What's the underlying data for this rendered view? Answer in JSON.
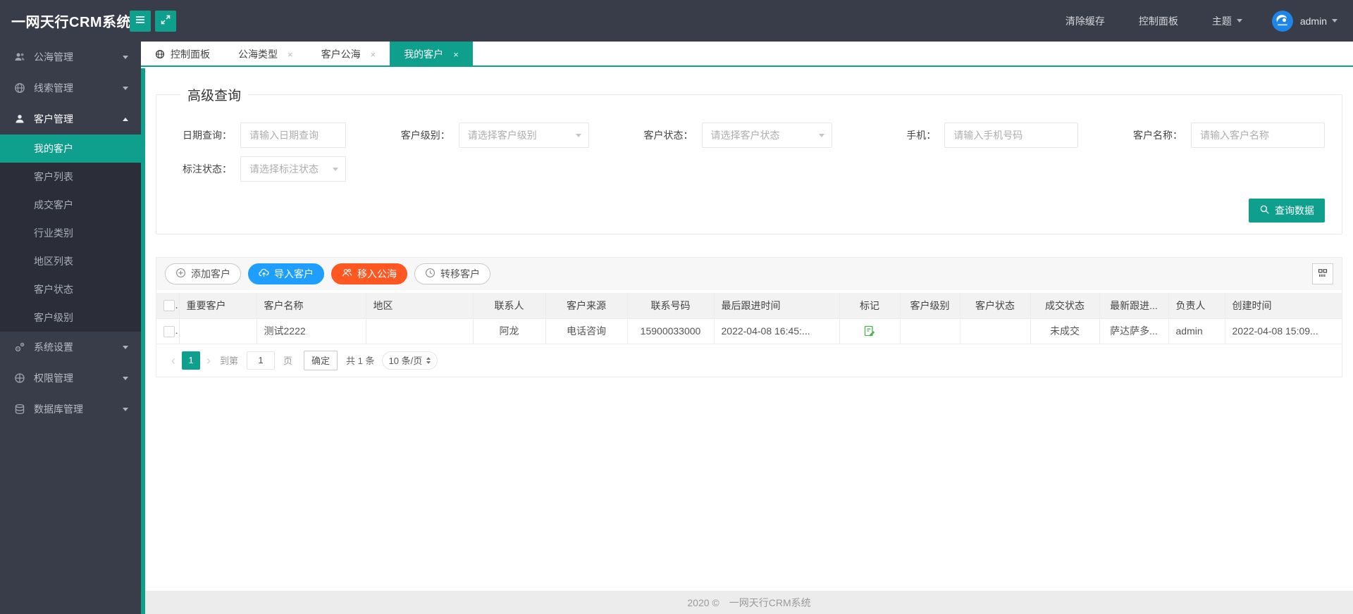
{
  "header": {
    "title": "一网天行CRM系统",
    "clear_cache": "清除缓存",
    "dashboard": "控制面板",
    "theme": "主题",
    "username": "admin"
  },
  "sidebar": {
    "items": [
      {
        "label": "公海管理",
        "icon": "users-icon"
      },
      {
        "label": "线索管理",
        "icon": "globe-icon"
      },
      {
        "label": "客户管理",
        "icon": "user-icon",
        "expanded": true,
        "children": [
          {
            "label": "我的客户",
            "active": true
          },
          {
            "label": "客户列表"
          },
          {
            "label": "成交客户"
          },
          {
            "label": "行业类别"
          },
          {
            "label": "地区列表"
          },
          {
            "label": "客户状态"
          },
          {
            "label": "客户级别"
          }
        ]
      },
      {
        "label": "系统设置",
        "icon": "gear-icon"
      },
      {
        "label": "权限管理",
        "icon": "permissions-icon"
      },
      {
        "label": "数据库管理",
        "icon": "database-icon"
      }
    ]
  },
  "tabs": [
    {
      "label": "控制面板",
      "icon": "globe-icon",
      "closable": false
    },
    {
      "label": "公海类型",
      "closable": true
    },
    {
      "label": "客户公海",
      "closable": true
    },
    {
      "label": "我的客户",
      "closable": true,
      "active": true
    }
  ],
  "query_form": {
    "legend": "高级查询",
    "fields": [
      {
        "label": "日期查询：",
        "placeholder": "请输入日期查询",
        "type": "input"
      },
      {
        "label": "客户级别：",
        "placeholder": "请选择客户级别",
        "type": "select"
      },
      {
        "label": "客户状态：",
        "placeholder": "请选择客户状态",
        "type": "select"
      },
      {
        "label": "手机：",
        "placeholder": "请输入手机号码",
        "type": "input"
      },
      {
        "label": "客户名称：",
        "placeholder": "请输入客户名称",
        "type": "input"
      },
      {
        "label": "标注状态：",
        "placeholder": "请选择标注状态",
        "type": "select"
      }
    ],
    "submit_label": "查询数据"
  },
  "toolbar": {
    "add_label": "添加客户",
    "import_label": "导入客户",
    "move_label": "移入公海",
    "transfer_label": "转移客户"
  },
  "table": {
    "columns": [
      "重要客户",
      "客户名称",
      "地区",
      "联系人",
      "客户来源",
      "联系号码",
      "最后跟进时间",
      "标记",
      "客户级别",
      "客户状态",
      "成交状态",
      "最新跟进...",
      "负责人",
      "创建时间"
    ],
    "rows": [
      {
        "cells": [
          "",
          "测试2222",
          "",
          "阿龙",
          "电话咨询",
          "15900033000",
          "2022-04-08 16:45:...",
          "",
          "",
          "",
          "未成交",
          "萨达萨多...",
          "admin",
          "2022-04-08 15:09..."
        ],
        "mark_icon": "edit-mark-icon"
      }
    ]
  },
  "pagination": {
    "prev": "‹",
    "current": "1",
    "next": "›",
    "goto_prefix": "到第",
    "page_value": "1",
    "goto_suffix": "页",
    "confirm_label": "确定",
    "total_label": "共 1 条",
    "page_size": "10 条/页"
  },
  "footer": {
    "year": "2020 ©",
    "name": "一网天行CRM系统"
  },
  "colors": {
    "accent_teal": "#0EA08D",
    "button_blue": "#1E9FFF",
    "button_orange": "#FF5722",
    "header_dark": "#393D49"
  }
}
